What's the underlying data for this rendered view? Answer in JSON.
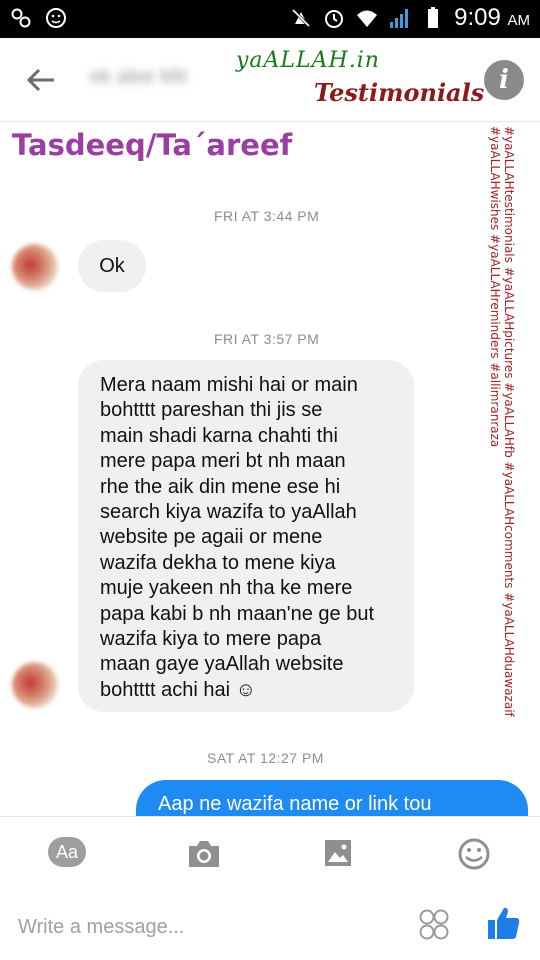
{
  "status_bar": {
    "time": "9:09",
    "ampm": "AM"
  },
  "header": {
    "contact_name": "ek alee Mit",
    "brand_top": "yaALLAH.in",
    "brand_main": "Testimonials",
    "info_glyph": "i"
  },
  "page_title": "Tasdeeq/Ta´areef",
  "side_tags": [
    "#yaALLAHtestimonials #yaALLAHpictures #yaALLAHfb #yaALLAHcomments #yaALLAHduawazaif",
    "#yaALLAHwishes #yaALLAHreminders #allimranraza"
  ],
  "messages": [
    {
      "timestamp": "FRI AT 3:44 PM",
      "text": "Ok"
    },
    {
      "timestamp": "FRI AT 3:57 PM",
      "lines": [
        "Mera naam mishi hai or main",
        "bohtttt pareshan thi jis se",
        "main shadi karna chahti thi",
        "mere papa meri bt nh maan",
        "rhe the aik din mene ese hi",
        "search kiya wazifa to yaAllah",
        "website pe agaii or mene",
        "wazifa dekha to mene kiya",
        "muje yakeen nh tha ke mere",
        "papa kabi b nh maan'ne ge but",
        "wazifa kiya to mere papa",
        "maan gaye yaAllah website",
        "bohtttt achi hai ☺"
      ]
    },
    {
      "timestamp": "SAT AT 12:27 PM",
      "text": "Aap ne wazifa name or link tou"
    }
  ],
  "composer": {
    "aa_label": "Aa",
    "placeholder": "Write a message..."
  },
  "colors": {
    "title": "#9b3ea3",
    "brand_top": "#1a7a1a",
    "brand_main": "#8b1a1a",
    "side_tags": "#a12222",
    "sent_bubble": "#1e8bf4",
    "received_bubble": "#f0f0f0"
  },
  "icons": {
    "status_left": [
      "messenger-icon",
      "smiley-icon"
    ],
    "status_right": [
      "mute-icon",
      "alarm-icon",
      "wifi-icon",
      "signal-icon",
      "battery-icon"
    ],
    "header": [
      "back-arrow-icon",
      "info-icon"
    ],
    "composer": [
      "camera-icon",
      "image-icon",
      "emoji-icon",
      "stickers-icon",
      "thumbs-up-icon"
    ]
  }
}
